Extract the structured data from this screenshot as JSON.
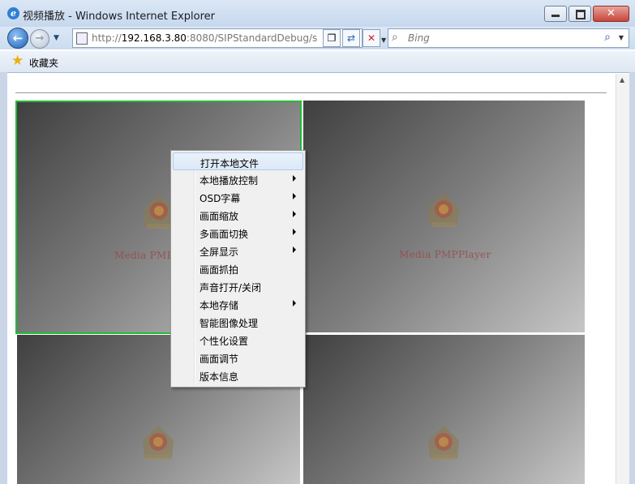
{
  "window": {
    "title": "视频播放 - Windows Internet Explorer",
    "app_icon": "e",
    "controls": {
      "close": "✕"
    }
  },
  "nav": {
    "address_protocol": "http://",
    "address_host": "192.168.3.80",
    "address_rest": ":8080/SIPStandardDebug/",
    "address_tail": "s",
    "search_placeholder": "Bing"
  },
  "favorites": {
    "label": "收藏夹"
  },
  "panes": [
    {
      "label": "Media PMPPlayer",
      "active": true
    },
    {
      "label": "Media PMPPlayer",
      "active": false
    },
    {
      "label": "",
      "active": false
    },
    {
      "label": "",
      "active": false
    }
  ],
  "context_menu": {
    "items": [
      {
        "label": "打开本地文件",
        "submenu": false,
        "highlighted": true
      },
      {
        "label": "本地播放控制",
        "submenu": true
      },
      {
        "label": "OSD字幕",
        "submenu": true
      },
      {
        "label": "画面缩放",
        "submenu": true
      },
      {
        "label": "多画面切换",
        "submenu": true
      },
      {
        "label": "全屏显示",
        "submenu": true
      },
      {
        "label": "画面抓拍",
        "submenu": false
      },
      {
        "label": "声音打开/关闭",
        "submenu": false
      },
      {
        "label": "本地存储",
        "submenu": true
      },
      {
        "label": "智能图像处理",
        "submenu": false
      },
      {
        "label": "个性化设置",
        "submenu": false
      },
      {
        "label": "画面调节",
        "submenu": false
      },
      {
        "label": "版本信息",
        "submenu": false
      }
    ]
  },
  "colors": {
    "active_pane_border": "#22bb33",
    "pane_dark": "#3f3f3f",
    "pane_light": "#c6c6c6",
    "watermark": "#9a4a4a"
  },
  "icons": {
    "back": "back-arrow-icon",
    "forward": "forward-arrow-icon",
    "compat": "compatibility-view-icon",
    "refresh": "refresh-icon",
    "stop": "stop-icon",
    "search": "search-icon",
    "favorites": "star-icon",
    "emblem": "police-emblem-icon"
  }
}
